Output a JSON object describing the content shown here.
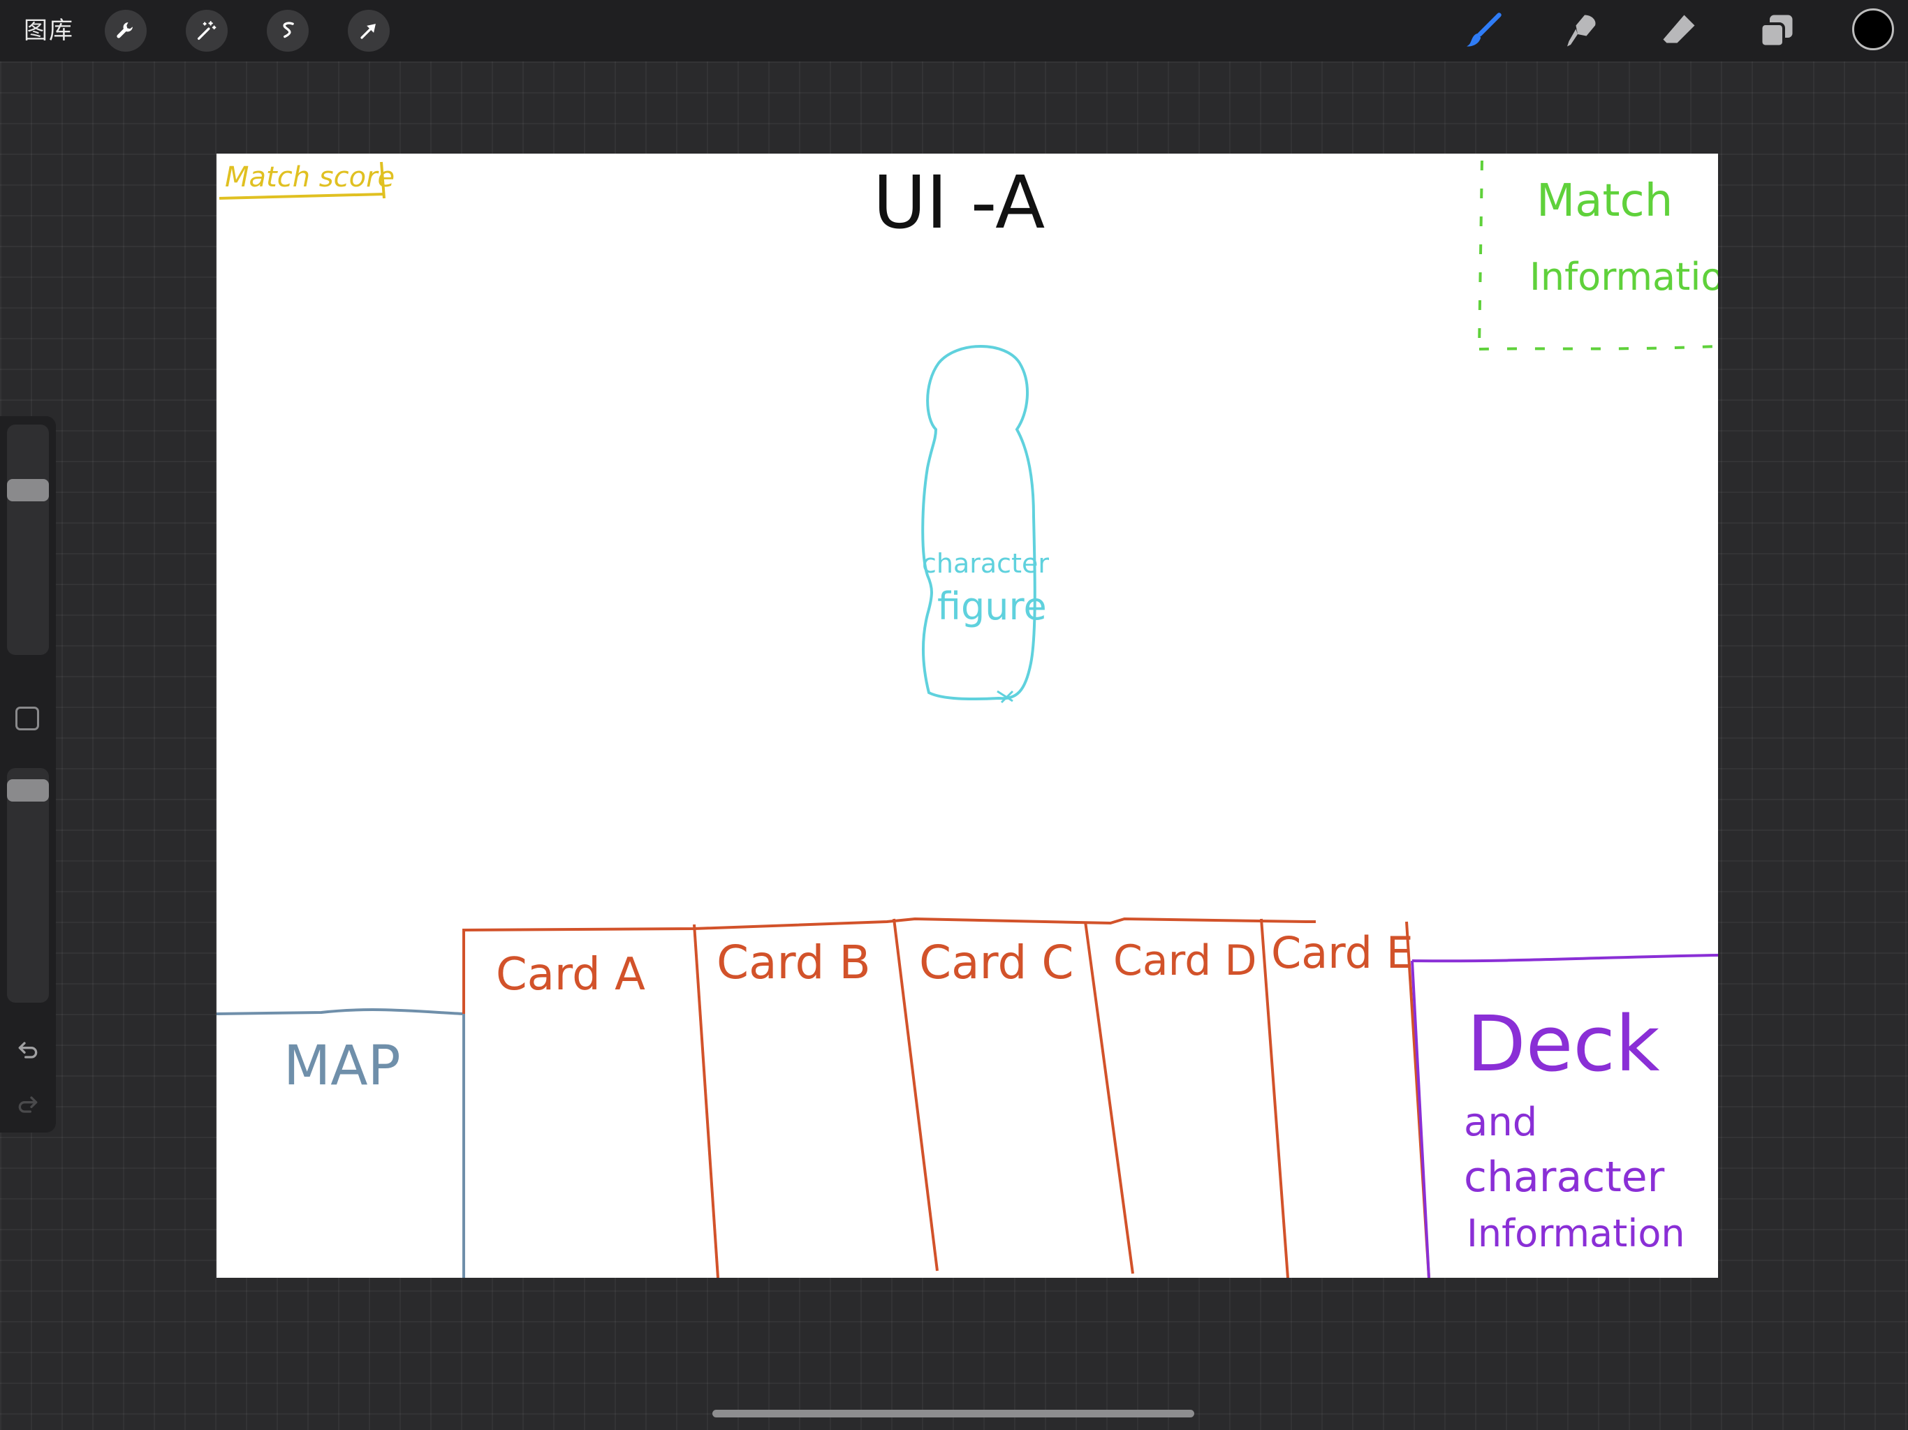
{
  "topbar": {
    "gallery_label": "图库",
    "left_tools": [
      "wrench-icon",
      "magic-wand-icon",
      "selection-icon",
      "transform-arrow-icon"
    ],
    "right_tools": [
      "brush-icon",
      "smudge-icon",
      "eraser-icon",
      "layers-icon"
    ],
    "active_tool": "brush",
    "accent_color": "#2f7cf6",
    "current_color": "#000000"
  },
  "sidebar": {
    "brush_size_level": 0.28,
    "opacity_level": 0.05,
    "buttons": [
      "modify-square",
      "undo-icon",
      "redo-icon"
    ]
  },
  "canvas": {
    "title": "UI -A",
    "match_score": "Match score",
    "match_information_line1": "Match",
    "match_information_line2": "Information",
    "character_line1": "character",
    "character_line2": "figure",
    "map_label": "MAP",
    "cards": [
      "Card A",
      "Card B",
      "Card C",
      "Card D",
      "Card E"
    ],
    "deck_line1": "Deck",
    "deck_line2": "and",
    "deck_line3": "character",
    "deck_line4": "Information",
    "colors": {
      "title": "#111111",
      "match_score": "#e0c021",
      "match_information": "#5fd13b",
      "character": "#5fd1dd",
      "map": "#6f8faa",
      "cards": "#d2522a",
      "deck": "#8a2fd6"
    }
  }
}
